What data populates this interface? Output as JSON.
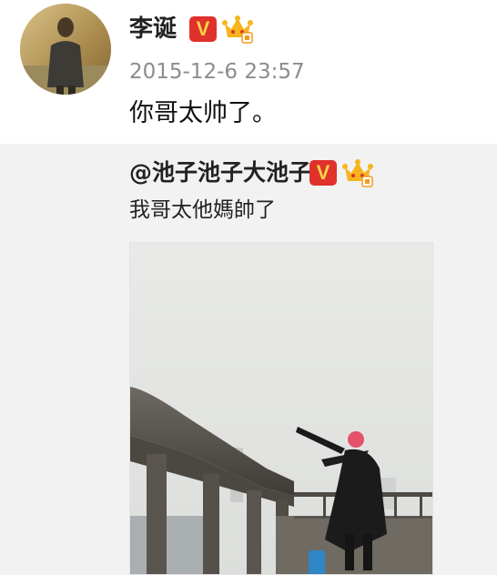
{
  "post": {
    "author": "李诞",
    "verified_badge": "V",
    "timestamp": "2015-12-6 23:57",
    "text": "你哥太帅了。"
  },
  "repost": {
    "author": "@池子池子大池子",
    "verified_badge": "V",
    "text": "我哥太他媽帥了"
  },
  "icons": {
    "verified": "verified-v-icon",
    "vip_crown": "vip-crown-icon"
  },
  "colors": {
    "verified_badge": "#e0312b",
    "crown": "#f6b51e",
    "repost_background": "#f2f2f2",
    "timestamp": "#8c8c8c"
  }
}
